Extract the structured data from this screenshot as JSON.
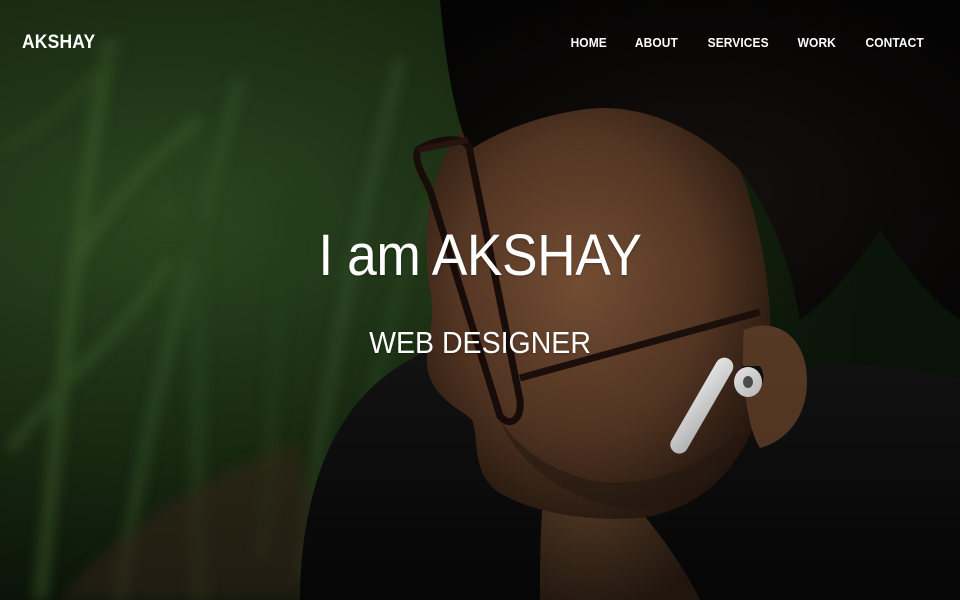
{
  "brand": {
    "name": "AKSHAY"
  },
  "nav": {
    "items": [
      {
        "label": "HOME"
      },
      {
        "label": "ABOUT"
      },
      {
        "label": "SERVICES"
      },
      {
        "label": "WORK"
      },
      {
        "label": "CONTACT"
      }
    ]
  },
  "hero": {
    "headline": "I am AKSHAY",
    "subheadline": "WEB DESIGNER",
    "background_image": "portrait-photo-man-glasses-earbud-grass"
  },
  "colors": {
    "text": "#ffffff",
    "grass_dark": "#142410",
    "grass_mid": "#2e4a22",
    "shirt": "#0c0c0c",
    "hair": "#0a0807",
    "skin": "#6e4a32"
  }
}
